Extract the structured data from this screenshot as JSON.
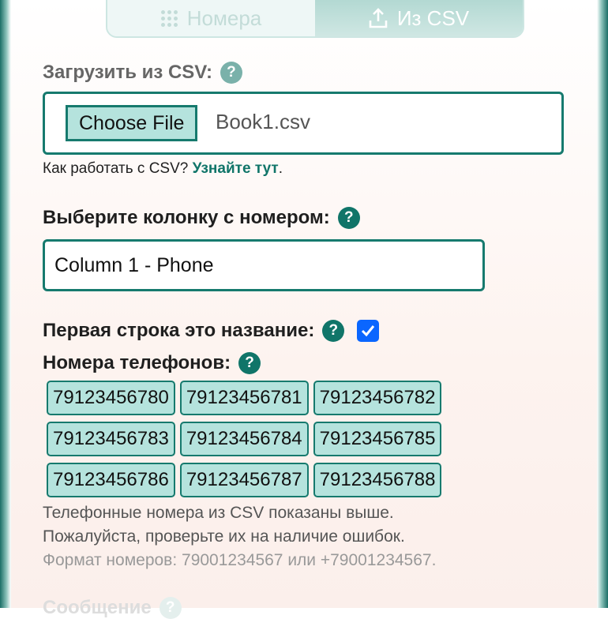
{
  "tabs": [
    {
      "label": "Номера",
      "icon": "dialpad-icon",
      "active": false
    },
    {
      "label": "Из CSV",
      "icon": "upload-icon",
      "active": true
    }
  ],
  "upload": {
    "label": "Загрузить из CSV:",
    "button_label": "Choose File",
    "file_name": "Book1.csv",
    "howto_text": "Как работать с CSV? ",
    "howto_link": "Узнайте тут",
    "howto_suffix": "."
  },
  "column": {
    "label": "Выберите колонку с номером:",
    "selected": "Column 1 - Phone"
  },
  "header_row": {
    "label": "Первая строка это название:",
    "checked": true
  },
  "phones": {
    "label": "Номера телефонов:",
    "items": [
      "79123456780",
      "79123456781",
      "79123456782",
      "79123456783",
      "79123456784",
      "79123456785",
      "79123456786",
      "79123456787",
      "79123456788"
    ]
  },
  "note": {
    "line1": "Телефонные номера из CSV показаны выше.",
    "line2": "Пожалуйста, проверьте их на наличие ошибок.",
    "format": "Формат номеров: 79001234567 или +79001234567."
  },
  "next_section": {
    "label": "Сообщение"
  },
  "help_glyph": "?",
  "colors": {
    "accent": "#107569",
    "chip_bg": "#b5e3dd",
    "checkbox": "#0a66ff"
  }
}
